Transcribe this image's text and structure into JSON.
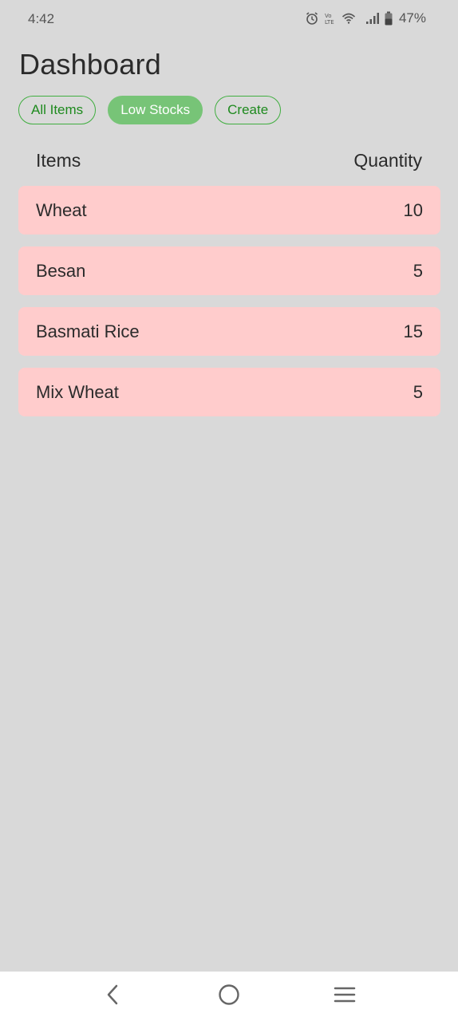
{
  "status_bar": {
    "time": "4:42",
    "battery": "47%",
    "icons": [
      "alarm-icon",
      "volte-icon",
      "wifi-icon",
      "signal-icon",
      "battery-icon"
    ]
  },
  "page": {
    "title": "Dashboard"
  },
  "filters": [
    {
      "label": "All Items",
      "active": false
    },
    {
      "label": "Low Stocks",
      "active": true
    },
    {
      "label": "Create",
      "active": false
    }
  ],
  "table": {
    "headers": {
      "item": "Items",
      "quantity": "Quantity"
    },
    "rows": [
      {
        "name": "Wheat",
        "quantity": "10"
      },
      {
        "name": "Besan",
        "quantity": "5"
      },
      {
        "name": "Basmati Rice",
        "quantity": "15"
      },
      {
        "name": "Mix Wheat",
        "quantity": "5"
      }
    ]
  },
  "nav_bar": {
    "icons": [
      "back-icon",
      "home-icon",
      "recent-apps-icon"
    ]
  },
  "colors": {
    "background": "#d9d9d9",
    "accent_green": "#3fae3f",
    "active_chip": "#77c477",
    "low_stock_row": "#ffcccc"
  }
}
